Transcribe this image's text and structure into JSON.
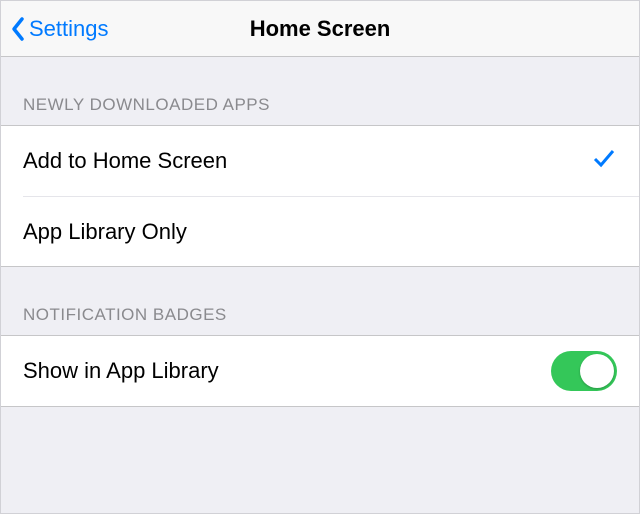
{
  "nav": {
    "back_label": "Settings",
    "title": "Home Screen"
  },
  "sections": {
    "downloads": {
      "header": "NEWLY DOWNLOADED APPS",
      "options": {
        "add_home": {
          "label": "Add to Home Screen",
          "selected": true
        },
        "library_only": {
          "label": "App Library Only",
          "selected": false
        }
      }
    },
    "badges": {
      "header": "NOTIFICATION BADGES",
      "show_in_library": {
        "label": "Show in App Library",
        "enabled": true
      }
    }
  },
  "colors": {
    "accent": "#007aff",
    "toggle_on": "#34c759"
  }
}
